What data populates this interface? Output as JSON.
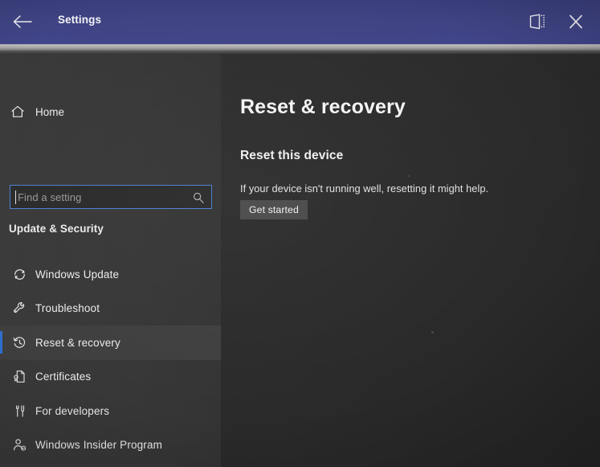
{
  "titlebar": {
    "title": "Settings",
    "back_icon": "back-arrow-icon",
    "project_icon": "project-screen-icon",
    "close_icon": "close-icon"
  },
  "sidebar": {
    "home": {
      "label": "Home",
      "icon": "home-icon"
    },
    "search": {
      "placeholder": "Find a setting",
      "value": "",
      "icon": "search-icon"
    },
    "section_header": "Update & Security",
    "items": [
      {
        "label": "Windows Update",
        "icon": "sync-refresh-icon",
        "selected": false
      },
      {
        "label": "Troubleshoot",
        "icon": "wrench-icon",
        "selected": false
      },
      {
        "label": "Reset & recovery",
        "icon": "history-clock-icon",
        "selected": true
      },
      {
        "label": "Certificates",
        "icon": "certificate-document-icon",
        "selected": false
      },
      {
        "label": "For developers",
        "icon": "tools-icon",
        "selected": false
      },
      {
        "label": "Windows Insider Program",
        "icon": "person-badge-icon",
        "selected": false
      }
    ]
  },
  "main": {
    "page_title": "Reset & recovery",
    "section_title": "Reset this device",
    "description": "If your device isn't running well, resetting it might help.",
    "get_started_label": "Get started"
  },
  "colors": {
    "titlebar": "#3f4382",
    "accent": "#2f6fd0",
    "search_focus_border": "#4d7fd0",
    "sidebar_bg": "#373737",
    "content_bg": "#2b2b2b",
    "button_bg": "#4a4a4a"
  }
}
